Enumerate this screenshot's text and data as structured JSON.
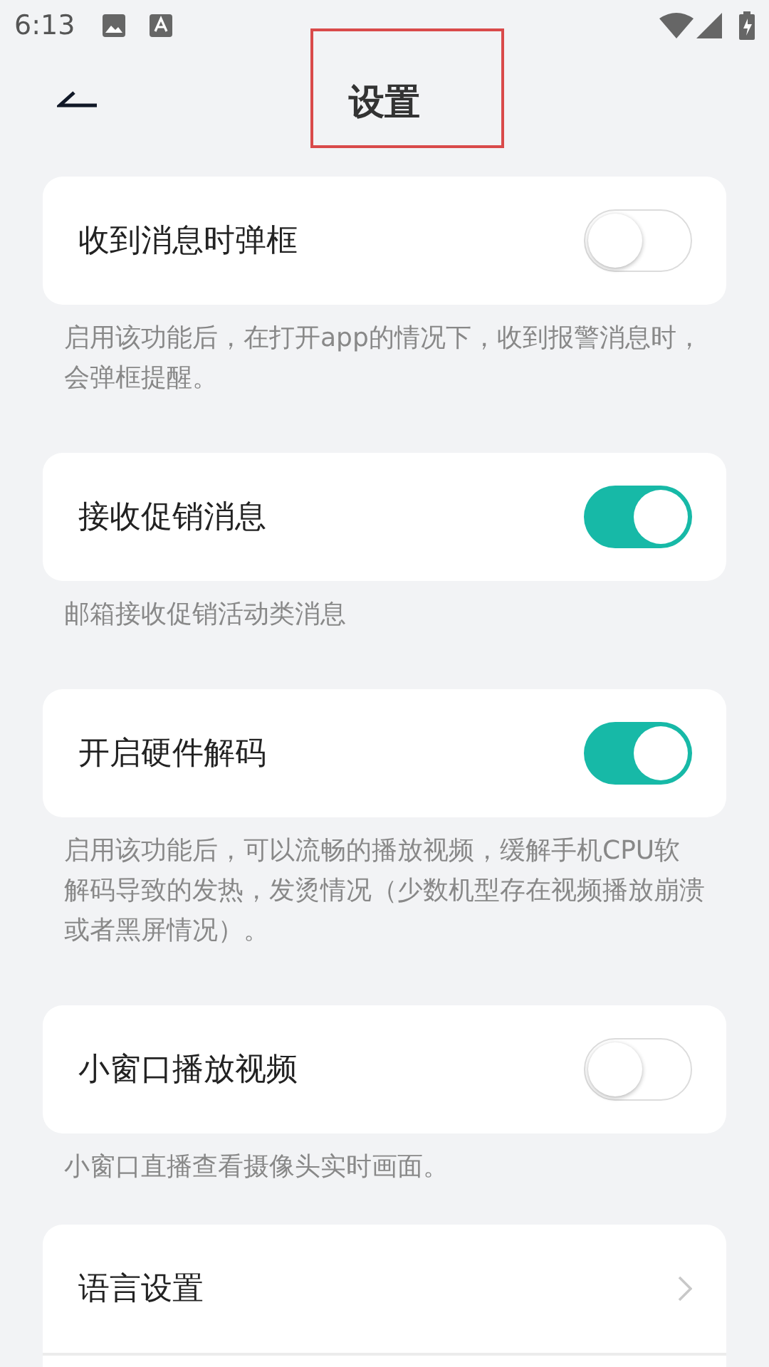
{
  "status_bar": {
    "time": "6:13"
  },
  "header": {
    "title": "设置"
  },
  "settings": [
    {
      "kind": "toggle",
      "label": "收到消息时弹框",
      "on": false,
      "description": "启用该功能后，在打开app的情况下，收到报警消息时，会弹框提醒。"
    },
    {
      "kind": "toggle",
      "label": "接收促销消息",
      "on": true,
      "description": "邮箱接收促销活动类消息"
    },
    {
      "kind": "toggle",
      "label": "开启硬件解码",
      "on": true,
      "description": "启用该功能后，可以流畅的播放视频，缓解手机CPU软解码导致的发热，发烫情况（少数机型存在视频播放崩溃或者黑屏情况）。"
    },
    {
      "kind": "toggle",
      "label": "小窗口播放视频",
      "on": false,
      "description": "小窗口直播查看摄像头实时画面。"
    },
    {
      "kind": "link",
      "label": "语言设置"
    }
  ]
}
